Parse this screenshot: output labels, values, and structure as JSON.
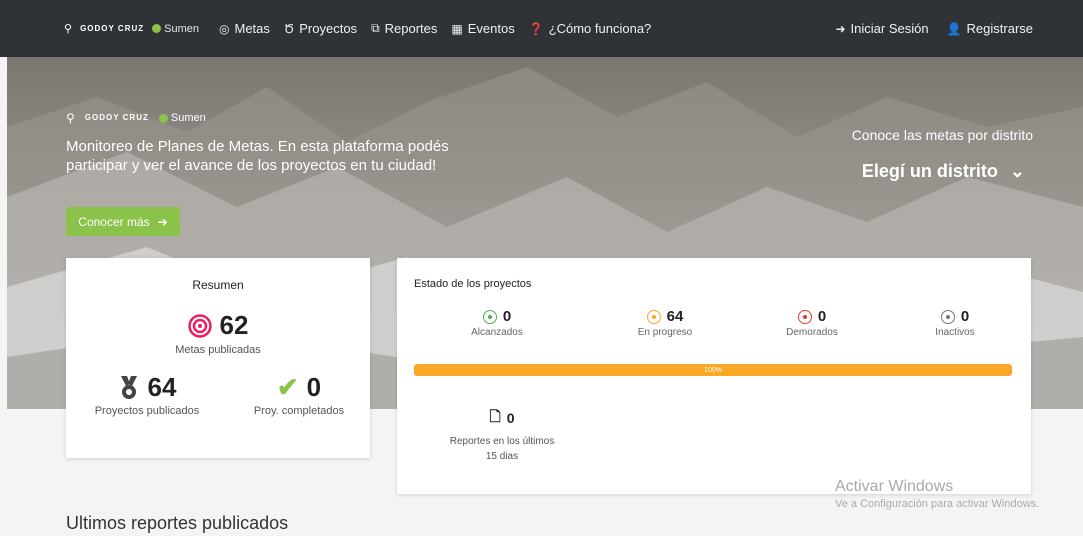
{
  "nav": {
    "brand_logo": "GODOY CRUZ",
    "brand_name": "Sumen",
    "items": [
      {
        "icon": "target-icon",
        "glyph": "◎",
        "label": "Metas"
      },
      {
        "icon": "medal-icon",
        "glyph": "Ծ",
        "label": "Proyectos"
      },
      {
        "icon": "files-icon",
        "glyph": "⧉",
        "label": "Reportes"
      },
      {
        "icon": "calendar-icon",
        "glyph": "▦",
        "label": "Eventos"
      },
      {
        "icon": "question-icon",
        "glyph": "❓",
        "label": "¿Cómo funciona?"
      }
    ],
    "login": "Iniciar Sesión",
    "register": "Registrarse"
  },
  "hero": {
    "brand_logo": "GODOY CRUZ",
    "brand_name": "Sumen",
    "text": "Monitoreo de Planes de Metas. En esta plataforma podés participar y ver el avance de los proyectos en tu ciudad!",
    "cta": "Conocer más",
    "district_title": "Conoce las metas por distrito",
    "district_select": "Elegí un distrito"
  },
  "summary": {
    "title": "Resumen",
    "metas_count": "62",
    "metas_label": "Metas publicadas",
    "projects_count": "64",
    "projects_label": "Proyectos publicados",
    "completed_count": "0",
    "completed_label": "Proy. completados"
  },
  "status": {
    "title": "Estado de los proyectos",
    "items": [
      {
        "count": "0",
        "label": "Alcanzados",
        "color": "#4caf50"
      },
      {
        "count": "64",
        "label": "En progreso",
        "color": "#f9a825"
      },
      {
        "count": "0",
        "label": "Demorados",
        "color": "#e53935"
      },
      {
        "count": "0",
        "label": "Inactivos",
        "color": "#777777"
      }
    ],
    "progress_label": "100%",
    "progress_value": 100,
    "reports_count": "0",
    "reports_label": "Reportes en los últimos 15 dias"
  },
  "last_reports_title": "Ultimos reportes publicados",
  "watermark": {
    "title": "Activar Windows",
    "subtitle": "Ve a Configuración para activar Windows."
  },
  "colors": {
    "accent_green": "#8bc34a",
    "navbar": "#2f3338",
    "target_pink": "#e91e63",
    "check_green": "#8bc34a"
  }
}
